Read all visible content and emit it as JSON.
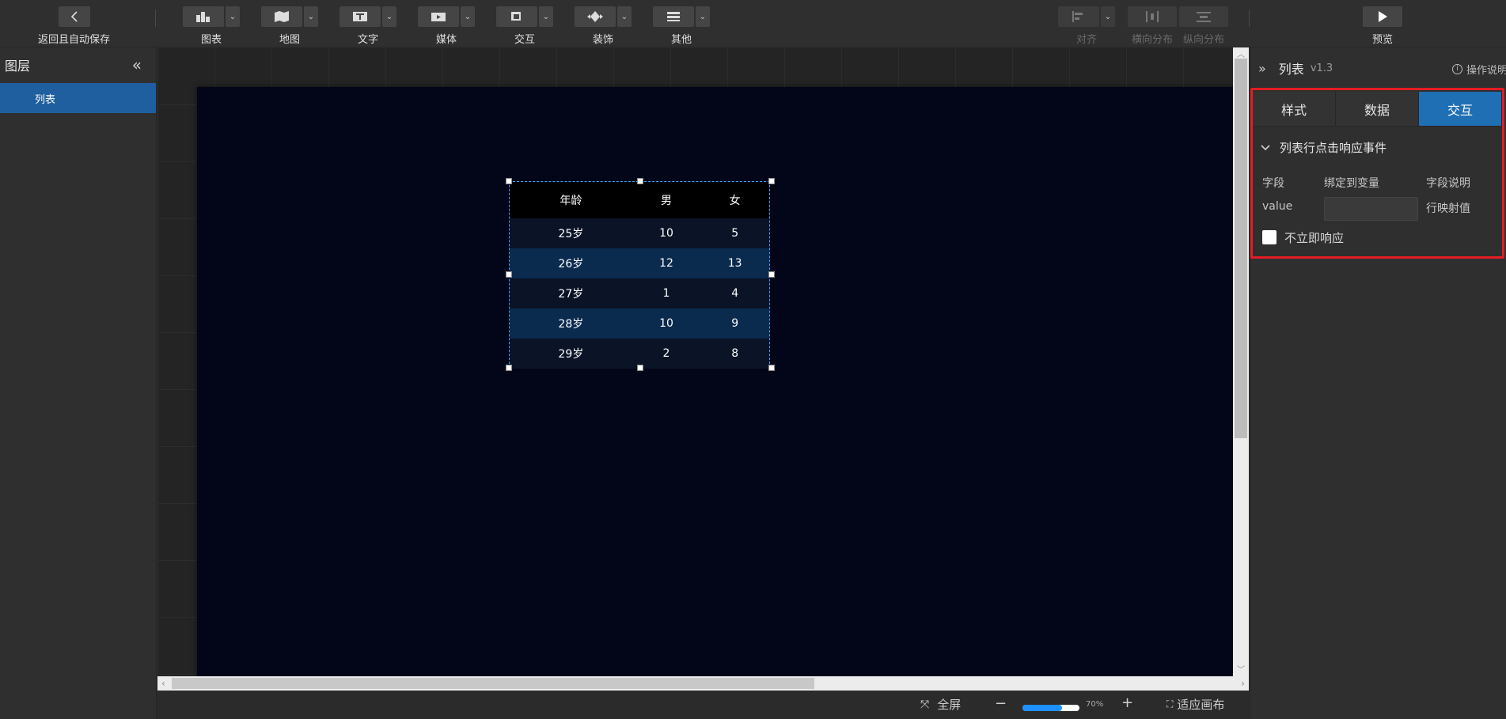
{
  "toolbar": {
    "back_label": "返回且自动保存",
    "groups": [
      {
        "label": "图表",
        "icon": "bar-chart-icon"
      },
      {
        "label": "地图",
        "icon": "map-icon"
      },
      {
        "label": "文字",
        "icon": "text-icon"
      },
      {
        "label": "媒体",
        "icon": "media-icon"
      },
      {
        "label": "交互",
        "icon": "interaction-icon"
      },
      {
        "label": "装饰",
        "icon": "decoration-icon"
      },
      {
        "label": "其他",
        "icon": "other-icon"
      }
    ],
    "align_label": "对齐",
    "hdist_label": "横向分布",
    "vdist_label": "纵向分布",
    "preview_label": "预览"
  },
  "layers": {
    "title": "图层",
    "items": [
      {
        "label": "列表"
      }
    ]
  },
  "table_widget": {
    "headers": [
      "年龄",
      "男",
      "女"
    ],
    "rows": [
      [
        "25岁",
        "10",
        "5"
      ],
      [
        "26岁",
        "12",
        "13"
      ],
      [
        "27岁",
        "1",
        "4"
      ],
      [
        "28岁",
        "10",
        "9"
      ],
      [
        "29岁",
        "2",
        "8"
      ]
    ]
  },
  "bottombar": {
    "fullscreen_label": "全屏",
    "zoom_value": "70%",
    "zoom_fraction": 0.7,
    "fit_label": "适应画布"
  },
  "properties": {
    "name": "列表",
    "version": "v1.3",
    "help_label": "操作说明",
    "tabs": [
      {
        "label": "样式",
        "active": false
      },
      {
        "label": "数据",
        "active": false
      },
      {
        "label": "交互",
        "active": true
      }
    ],
    "section_title": "列表行点击响应事件",
    "field_header": "字段",
    "bind_header": "绑定到变量",
    "desc_header": "字段说明",
    "field_name": "value",
    "field_value": "",
    "field_desc": "行映射值",
    "checkbox_label": "不立即响应"
  },
  "colors": {
    "accent": "#1f6fb5",
    "highlight_border": "#e51c23",
    "canvas_bg": "#020618"
  }
}
